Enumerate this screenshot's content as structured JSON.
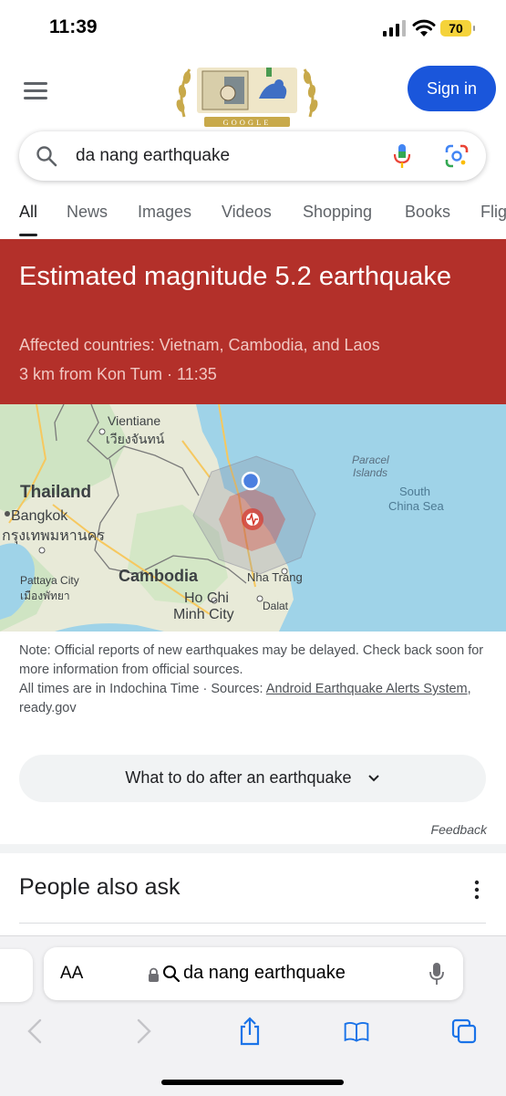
{
  "status": {
    "time": "11:39",
    "battery": "70"
  },
  "header": {
    "signin_label": "Sign in",
    "doodle_text": "GOOGLE"
  },
  "search": {
    "query": "da nang earthquake"
  },
  "tabs": [
    {
      "label": "All",
      "active": true
    },
    {
      "label": "News"
    },
    {
      "label": "Images"
    },
    {
      "label": "Videos"
    },
    {
      "label": "Shopping"
    },
    {
      "label": "Books"
    },
    {
      "label": "Flig"
    }
  ],
  "alert": {
    "title": "Estimated magnitude 5.2 earthquake",
    "affected": "Affected countries: Vietnam, Cambodia, and Laos",
    "location_time": "3 km from Kon Tum · 11:35",
    "color": "#b3302a"
  },
  "map": {
    "labels": {
      "vientiane": "Vientiane",
      "vientiane_th": "เวียงจันทน์",
      "thailand": "Thailand",
      "bangkok": "Bangkok",
      "bangkok_th": "กรุงเทพมหานคร",
      "pattaya": "Pattaya City",
      "pattaya_th": "เมืองพัทยา",
      "cambodia": "Cambodia",
      "hochiminh1": "Ho Chi",
      "hochiminh2": "Minh City",
      "nhatrang": "Nha Trang",
      "dalat": "Dalat",
      "paracel1": "Paracel",
      "paracel2": "Islands",
      "scs1": "South",
      "scs2": "China Sea"
    }
  },
  "note": {
    "line1": "Note: Official reports of new earthquakes may be delayed. Check back soon for more information from official sources.",
    "line2_prefix": "All times are in Indochina Time · Sources: ",
    "source_link": "Android Earthquake Alerts System",
    "line2_suffix": ", ready.gov"
  },
  "what_to_do": "What to do after an earthquake",
  "feedback": "Feedback",
  "people_also_ask": "People also ask",
  "safari": {
    "aa": "AA",
    "url": "da nang earthquake"
  }
}
